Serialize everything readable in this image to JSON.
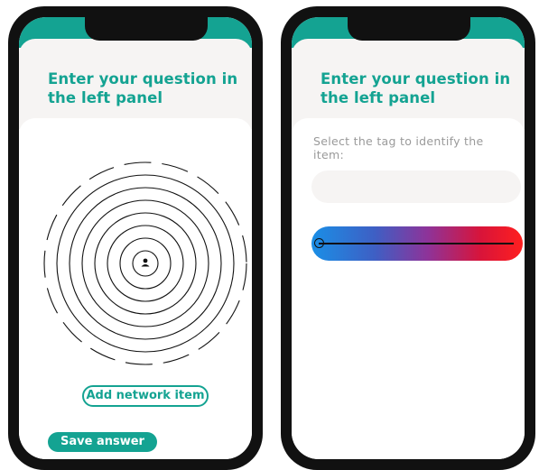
{
  "left_phone": {
    "question_title": "Enter your question in the left panel",
    "add_network_item_label": "Add network item",
    "save_answer_label": "Save answer"
  },
  "right_phone": {
    "question_title": "Enter your question in the left panel",
    "tag_label": "Select the tag to identify the item:",
    "tag_input_value": "",
    "gradient_slider_value": 0
  },
  "icons": {
    "center_node": "person-icon",
    "rings": "network-rings-icon"
  },
  "colors": {
    "accent": "#14a392",
    "phone_frame": "#111111",
    "panel_bg": "#f6f4f3",
    "gradient_start": "#1a8fe6",
    "gradient_end": "#ff1f1f"
  }
}
